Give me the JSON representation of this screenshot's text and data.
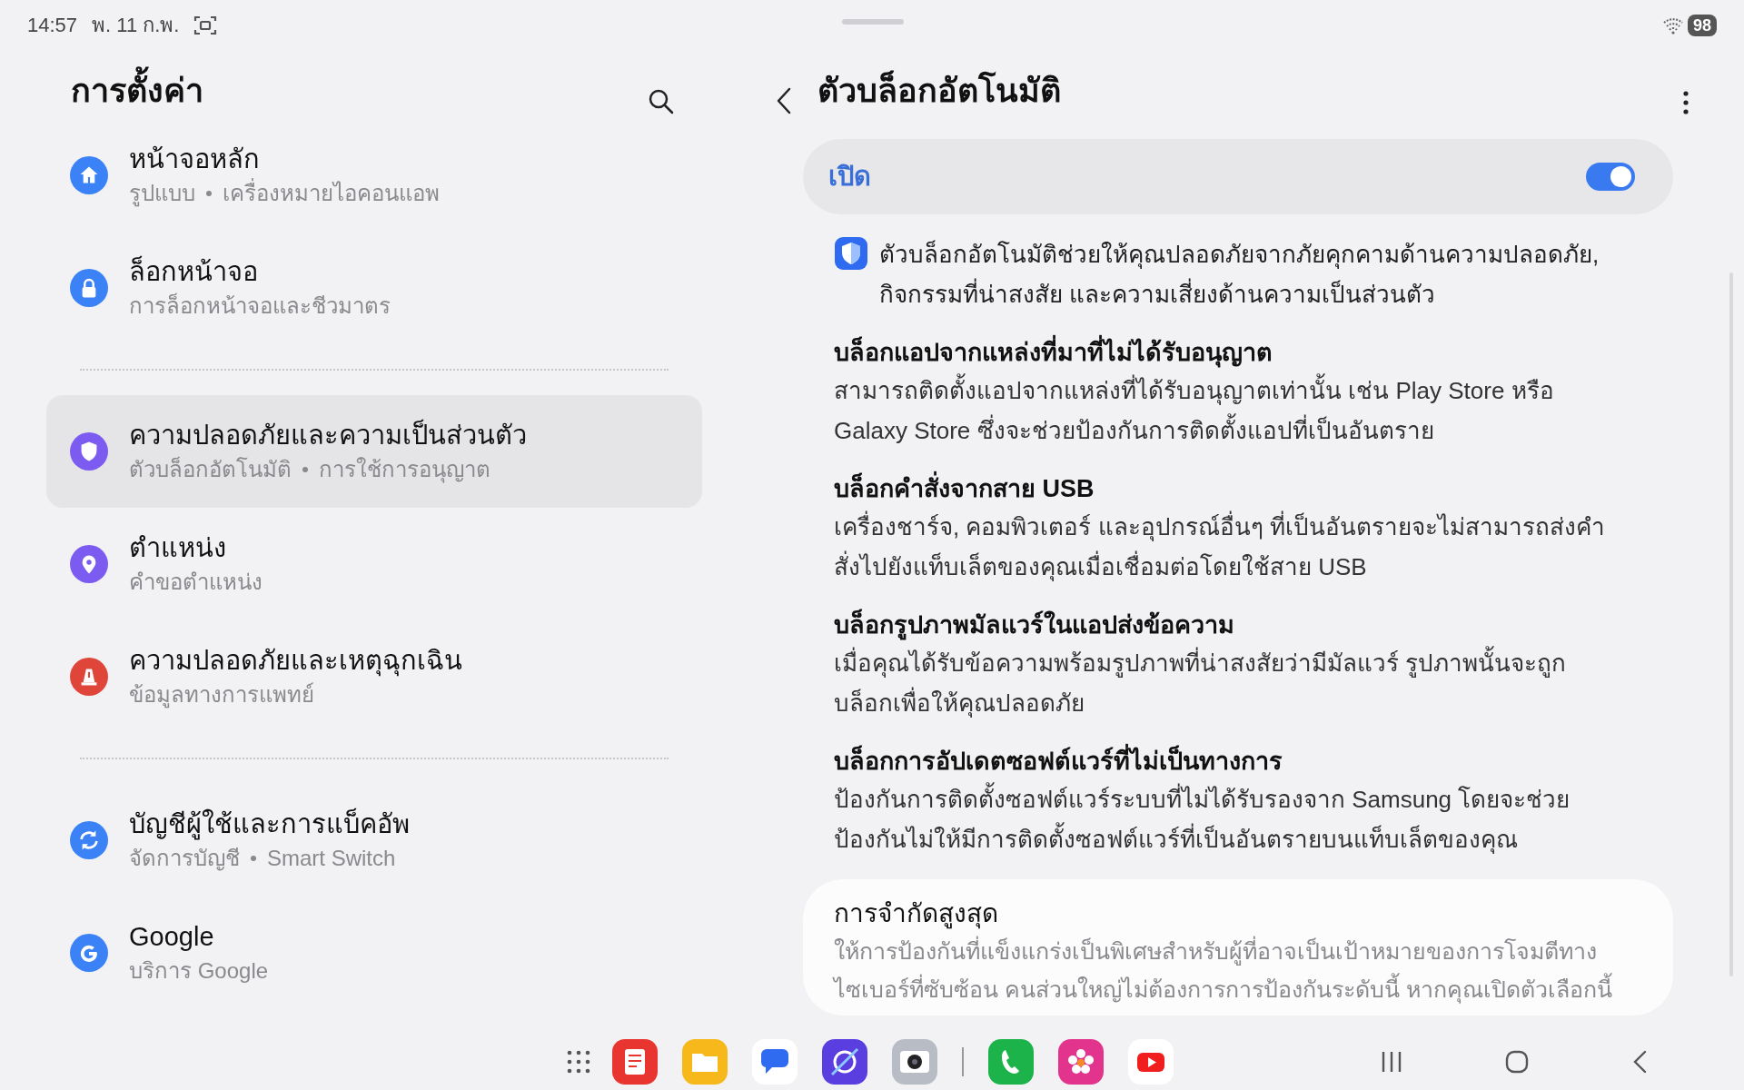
{
  "status_bar": {
    "time": "14:57",
    "date": "พ. 11 ก.พ.",
    "battery": "98"
  },
  "settings_panel": {
    "title": "การตั้งค่า",
    "groups": [
      {
        "items": [
          {
            "title": "หน้าจอหลัก",
            "subtitle": [
              "รูปแบบ",
              "เครื่องหมายไอคอนแอพ"
            ],
            "kind": "home",
            "color": "#3b82f6",
            "selected": false
          },
          {
            "title": "ล็อกหน้าจอ",
            "subtitle": [
              "การล็อกหน้าจอและชีวมาตร"
            ],
            "kind": "lock",
            "color": "#3b82f6",
            "selected": false
          }
        ]
      },
      {
        "items": [
          {
            "title": "ความปลอดภัยและความเป็นส่วนตัว",
            "subtitle": [
              "ตัวบล็อกอัตโนมัติ",
              "การใช้การอนุญาต"
            ],
            "kind": "shield",
            "color": "#7c5cf0",
            "selected": true
          },
          {
            "title": "ตำแหน่ง",
            "subtitle": [
              "คำขอตำแหน่ง"
            ],
            "kind": "pin",
            "color": "#7c5cf0",
            "selected": false
          },
          {
            "title": "ความปลอดภัยและเหตุฉุกเฉิน",
            "subtitle": [
              "ข้อมูลทางการแพทย์"
            ],
            "kind": "alert",
            "color": "#e0453a",
            "selected": false
          }
        ]
      },
      {
        "items": [
          {
            "title": "บัญชีผู้ใช้และการแบ็คอัพ",
            "subtitle": [
              "จัดการบัญชี",
              "Smart Switch"
            ],
            "kind": "sync",
            "color": "#3b82f6",
            "selected": false
          },
          {
            "title": "Google",
            "subtitle": [
              "บริการ Google"
            ],
            "kind": "google",
            "color": "#3b82f6",
            "selected": false
          }
        ]
      }
    ]
  },
  "detail_panel": {
    "title": "ตัวบล็อกอัตโนมัติ",
    "master_switch": {
      "label": "เปิด",
      "on": true
    },
    "intro": "ตัวบล็อกอัตโนมัติช่วยให้คุณปลอดภัยจากภัยคุกคามด้านความปลอดภัย, กิจกรรมที่น่าสงสัย และความเสี่ยงด้านความเป็นส่วนตัว",
    "sections": [
      {
        "heading": "บล็อกแอปจากแหล่งที่มาที่ไม่ได้รับอนุญาต",
        "body": "สามารถติดตั้งแอปจากแหล่งที่ได้รับอนุญาตเท่านั้น เช่น Play Store หรือ Galaxy Store ซึ่งจะช่วยป้องกันการติดตั้งแอปที่เป็นอันตราย"
      },
      {
        "heading": "บล็อกคำสั่งจากสาย USB",
        "body": "เครื่องชาร์จ, คอมพิวเตอร์ และอุปกรณ์อื่นๆ ที่เป็นอันตรายจะไม่สามารถส่งคำสั่งไปยังแท็บเล็ตของคุณเมื่อเชื่อมต่อโดยใช้สาย USB"
      },
      {
        "heading": "บล็อกรูปภาพมัลแวร์ในแอปส่งข้อความ",
        "body": "เมื่อคุณได้รับข้อความพร้อมรูปภาพที่น่าสงสัยว่ามีมัลแวร์ รูปภาพนั้นจะถูกบล็อกเพื่อให้คุณปลอดภัย"
      },
      {
        "heading": "บล็อกการอัปเดตซอฟต์แวร์ที่ไม่เป็นทางการ",
        "body": "ป้องกันการติดตั้งซอฟต์แวร์ระบบที่ไม่ได้รับรองจาก Samsung โดยจะช่วยป้องกันไม่ให้มีการติดตั้งซอฟต์แวร์ที่เป็นอันตรายบนแท็บเล็ตของคุณ"
      }
    ],
    "option_card": {
      "title": "การจำกัดสูงสุด",
      "description": "ให้การป้องกันที่แข็งแกร่งเป็นพิเศษสำหรับผู้ที่อาจเป็นเป้าหมายของการโจมตีทางไซเบอร์ที่ซับซ้อน คนส่วนใหญ่ไม่ต้องการการป้องกันระดับนี้ หากคุณเปิดตัวเลือกนี้"
    }
  },
  "dock": {
    "apps": [
      {
        "kind": "notes"
      },
      {
        "kind": "files"
      },
      {
        "kind": "messages"
      },
      {
        "kind": "internet"
      },
      {
        "kind": "camera"
      },
      {
        "kind": "phone"
      },
      {
        "kind": "gallery"
      },
      {
        "kind": "youtube"
      }
    ]
  }
}
